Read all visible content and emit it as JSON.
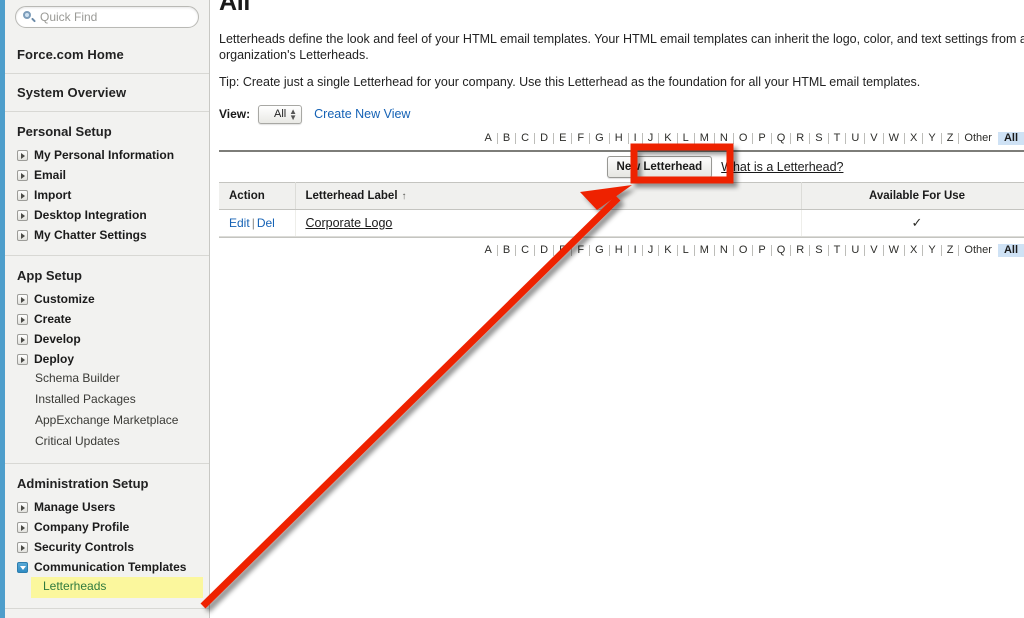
{
  "sidebar": {
    "quick_find": {
      "placeholder": "Quick Find",
      "icon": "search-icon"
    },
    "home_link": "Force.com Home",
    "system_overview_link": "System Overview",
    "sections": [
      {
        "title": "Personal Setup",
        "items": [
          {
            "label": "My Personal Information",
            "twisty": "collapsed"
          },
          {
            "label": "Email",
            "twisty": "collapsed"
          },
          {
            "label": "Import",
            "twisty": "collapsed"
          },
          {
            "label": "Desktop Integration",
            "twisty": "collapsed"
          },
          {
            "label": "My Chatter Settings",
            "twisty": "collapsed"
          }
        ]
      },
      {
        "title": "App Setup",
        "items": [
          {
            "label": "Customize",
            "twisty": "collapsed"
          },
          {
            "label": "Create",
            "twisty": "collapsed"
          },
          {
            "label": "Develop",
            "twisty": "collapsed"
          },
          {
            "label": "Deploy",
            "twisty": "collapsed"
          }
        ],
        "sub_items": [
          {
            "label": "Schema Builder",
            "selected": false
          },
          {
            "label": "Installed Packages",
            "selected": false
          },
          {
            "label": "AppExchange Marketplace",
            "selected": false
          },
          {
            "label": "Critical Updates",
            "selected": false
          }
        ]
      },
      {
        "title": "Administration Setup",
        "items": [
          {
            "label": "Manage Users",
            "twisty": "collapsed"
          },
          {
            "label": "Company Profile",
            "twisty": "collapsed"
          },
          {
            "label": "Security Controls",
            "twisty": "collapsed"
          },
          {
            "label": "Communication Templates",
            "twisty": "expanded"
          }
        ],
        "sub_items": [
          {
            "label": "Letterheads",
            "selected": true
          }
        ]
      }
    ]
  },
  "main": {
    "page_title": "All",
    "paragraph_1": "Letterheads define the look and feel of your HTML email templates. Your HTML email templates can inherit the logo, color, and text settings from a organization's Letterheads.",
    "paragraph_2": "Tip: Create just a single Letterhead for your company. Use this Letterhead as the foundation for all your HTML email templates.",
    "view": {
      "label": "View:",
      "selected": "All",
      "create_new_view": "Create New View"
    },
    "alpha_index": {
      "letters": [
        "A",
        "B",
        "C",
        "D",
        "E",
        "F",
        "G",
        "H",
        "I",
        "J",
        "K",
        "L",
        "M",
        "N",
        "O",
        "P",
        "Q",
        "R",
        "S",
        "T",
        "U",
        "V",
        "W",
        "X",
        "Y",
        "Z"
      ],
      "other": "Other",
      "all": "All",
      "active": "All"
    },
    "toolbar": {
      "new_letterhead_button": "New Letterhead",
      "what_is_link": "What is a Letterhead?"
    },
    "table": {
      "columns": [
        "Action",
        "Letterhead Label",
        "Available For Use"
      ],
      "sort_column": "Letterhead Label",
      "sort_direction": "ascending",
      "sort_glyph": "↑",
      "rows": [
        {
          "action_edit": "Edit",
          "action_separator": "|",
          "action_delete": "Del",
          "label": "Corporate Logo",
          "available_for_use": "✓"
        }
      ]
    }
  },
  "annotation": {
    "arrow_color": "#ee2200",
    "highlight_color": "#ee2200",
    "target": "New Letterhead button"
  },
  "colors": {
    "accent_blue": "#4e9ecb",
    "link_blue": "#1562b5",
    "sidebar_bg": "#f2f2f0",
    "selected_yellow": "#fbf79d",
    "selected_text_green": "#2f7a3e",
    "alpha_active_bg": "#cfe2f5",
    "annotation_red": "#ee2200"
  }
}
